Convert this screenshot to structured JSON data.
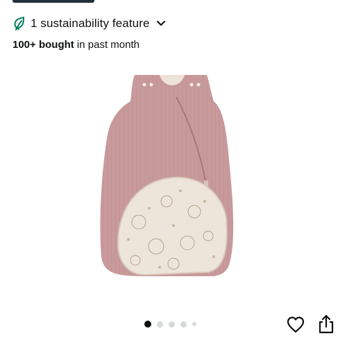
{
  "sustainability": {
    "label": "1 sustainability feature",
    "leaf_icon": "leaf-icon",
    "chevron_icon": "chevron-down-icon",
    "leaf_color": "#067d62"
  },
  "purchase_stats": {
    "count": "100+ bought",
    "period": " in past month"
  },
  "product_image": {
    "alt": ""
  },
  "carousel": {
    "total_dots": 5,
    "active_index": 0
  },
  "actions": {
    "wishlist_icon": "heart-icon",
    "share_icon": "share-icon"
  }
}
